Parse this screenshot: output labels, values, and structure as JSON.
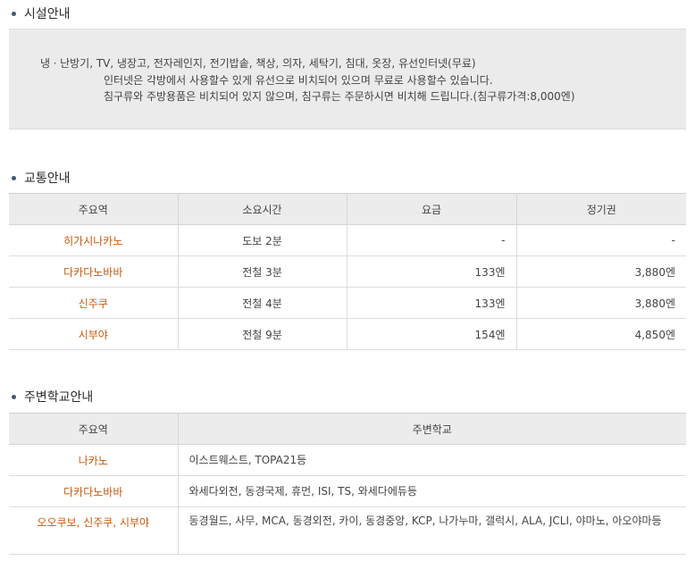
{
  "facility": {
    "title": "시설안내",
    "lines": [
      "냉ㆍ난방기, TV, 냉장고, 전자레인지, 전기밥솥, 책상, 의자, 세탁기, 침대, 옷장, 유선인터넷(무료)",
      "인터넷은 각방에서 사용할수 있게 유선으로 비치되어 있으며 무료로 사용할수 있습니다.",
      "침구류와 주방용품은 비치되어 있지 않으며, 침구류는 주문하시면 비치해 드립니다.(침구류가격:8,000엔)"
    ]
  },
  "traffic": {
    "title": "교통안내",
    "headers": [
      "주요역",
      "소요시간",
      "요금",
      "정기권"
    ],
    "rows": [
      {
        "station": "히가시나카노",
        "time": "도보 2분",
        "fare": "-",
        "pass": "-"
      },
      {
        "station": "다카다노바바",
        "time": "전철 3분",
        "fare": "133엔",
        "pass": "3,880엔"
      },
      {
        "station": "신주쿠",
        "time": "전철 4분",
        "fare": "133엔",
        "pass": "3,880엔"
      },
      {
        "station": "시부야",
        "time": "전철 9분",
        "fare": "154엔",
        "pass": "4,850엔"
      }
    ]
  },
  "schools": {
    "title": "주변학교안내",
    "headers": [
      "주요역",
      "주변학교"
    ],
    "rows": [
      {
        "station": "나카노",
        "schools": "이스트웨스트, TOPA21등"
      },
      {
        "station": "다카다노바바",
        "schools": "와세다외전, 동경국제, 휴먼, ISI, TS, 와세다에듀등"
      },
      {
        "station": "오오쿠보, 신주쿠, 시부야",
        "schools": "동경월드, 사무, MCA, 동경외전, 카이, 동경중앙, KCP, 나가누마, 갤럭시, ALA, JCLI, 야마노, 아오야마등"
      }
    ]
  },
  "colors": {
    "accent_station": "#c55a11",
    "header_bg": "#ececec",
    "box_bg": "#ebebeb",
    "bullet": "#3c5a70"
  }
}
